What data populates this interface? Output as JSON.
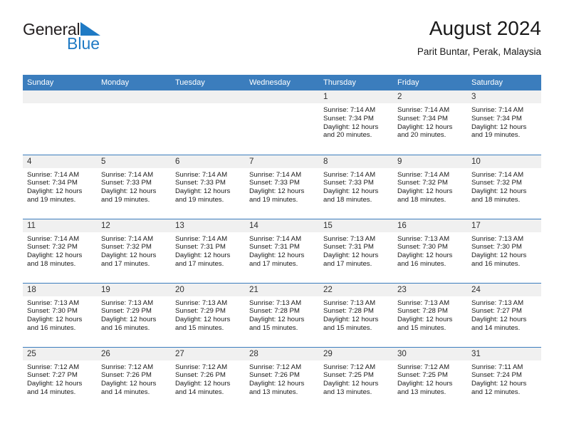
{
  "brand": {
    "name_part1": "General",
    "name_part2": "Blue",
    "accent_color": "#1f7ac4"
  },
  "header": {
    "title": "August 2024",
    "subtitle": "Parit Buntar, Perak, Malaysia"
  },
  "theme": {
    "header_bg": "#3b7dbd",
    "daynum_bg": "#f0f0f0",
    "text": "#1a1a1a"
  },
  "weekday_headers": [
    "Sunday",
    "Monday",
    "Tuesday",
    "Wednesday",
    "Thursday",
    "Friday",
    "Saturday"
  ],
  "labels": {
    "sunrise": "Sunrise:",
    "sunset": "Sunset:",
    "daylight": "Daylight:"
  },
  "weeks": [
    [
      {
        "day": "",
        "lines": []
      },
      {
        "day": "",
        "lines": []
      },
      {
        "day": "",
        "lines": []
      },
      {
        "day": "",
        "lines": []
      },
      {
        "day": "1",
        "lines": [
          "Sunrise: 7:14 AM",
          "Sunset: 7:34 PM",
          "Daylight: 12 hours",
          "and 20 minutes."
        ]
      },
      {
        "day": "2",
        "lines": [
          "Sunrise: 7:14 AM",
          "Sunset: 7:34 PM",
          "Daylight: 12 hours",
          "and 20 minutes."
        ]
      },
      {
        "day": "3",
        "lines": [
          "Sunrise: 7:14 AM",
          "Sunset: 7:34 PM",
          "Daylight: 12 hours",
          "and 19 minutes."
        ]
      }
    ],
    [
      {
        "day": "4",
        "lines": [
          "Sunrise: 7:14 AM",
          "Sunset: 7:34 PM",
          "Daylight: 12 hours",
          "and 19 minutes."
        ]
      },
      {
        "day": "5",
        "lines": [
          "Sunrise: 7:14 AM",
          "Sunset: 7:33 PM",
          "Daylight: 12 hours",
          "and 19 minutes."
        ]
      },
      {
        "day": "6",
        "lines": [
          "Sunrise: 7:14 AM",
          "Sunset: 7:33 PM",
          "Daylight: 12 hours",
          "and 19 minutes."
        ]
      },
      {
        "day": "7",
        "lines": [
          "Sunrise: 7:14 AM",
          "Sunset: 7:33 PM",
          "Daylight: 12 hours",
          "and 19 minutes."
        ]
      },
      {
        "day": "8",
        "lines": [
          "Sunrise: 7:14 AM",
          "Sunset: 7:33 PM",
          "Daylight: 12 hours",
          "and 18 minutes."
        ]
      },
      {
        "day": "9",
        "lines": [
          "Sunrise: 7:14 AM",
          "Sunset: 7:32 PM",
          "Daylight: 12 hours",
          "and 18 minutes."
        ]
      },
      {
        "day": "10",
        "lines": [
          "Sunrise: 7:14 AM",
          "Sunset: 7:32 PM",
          "Daylight: 12 hours",
          "and 18 minutes."
        ]
      }
    ],
    [
      {
        "day": "11",
        "lines": [
          "Sunrise: 7:14 AM",
          "Sunset: 7:32 PM",
          "Daylight: 12 hours",
          "and 18 minutes."
        ]
      },
      {
        "day": "12",
        "lines": [
          "Sunrise: 7:14 AM",
          "Sunset: 7:32 PM",
          "Daylight: 12 hours",
          "and 17 minutes."
        ]
      },
      {
        "day": "13",
        "lines": [
          "Sunrise: 7:14 AM",
          "Sunset: 7:31 PM",
          "Daylight: 12 hours",
          "and 17 minutes."
        ]
      },
      {
        "day": "14",
        "lines": [
          "Sunrise: 7:14 AM",
          "Sunset: 7:31 PM",
          "Daylight: 12 hours",
          "and 17 minutes."
        ]
      },
      {
        "day": "15",
        "lines": [
          "Sunrise: 7:13 AM",
          "Sunset: 7:31 PM",
          "Daylight: 12 hours",
          "and 17 minutes."
        ]
      },
      {
        "day": "16",
        "lines": [
          "Sunrise: 7:13 AM",
          "Sunset: 7:30 PM",
          "Daylight: 12 hours",
          "and 16 minutes."
        ]
      },
      {
        "day": "17",
        "lines": [
          "Sunrise: 7:13 AM",
          "Sunset: 7:30 PM",
          "Daylight: 12 hours",
          "and 16 minutes."
        ]
      }
    ],
    [
      {
        "day": "18",
        "lines": [
          "Sunrise: 7:13 AM",
          "Sunset: 7:30 PM",
          "Daylight: 12 hours",
          "and 16 minutes."
        ]
      },
      {
        "day": "19",
        "lines": [
          "Sunrise: 7:13 AM",
          "Sunset: 7:29 PM",
          "Daylight: 12 hours",
          "and 16 minutes."
        ]
      },
      {
        "day": "20",
        "lines": [
          "Sunrise: 7:13 AM",
          "Sunset: 7:29 PM",
          "Daylight: 12 hours",
          "and 15 minutes."
        ]
      },
      {
        "day": "21",
        "lines": [
          "Sunrise: 7:13 AM",
          "Sunset: 7:28 PM",
          "Daylight: 12 hours",
          "and 15 minutes."
        ]
      },
      {
        "day": "22",
        "lines": [
          "Sunrise: 7:13 AM",
          "Sunset: 7:28 PM",
          "Daylight: 12 hours",
          "and 15 minutes."
        ]
      },
      {
        "day": "23",
        "lines": [
          "Sunrise: 7:13 AM",
          "Sunset: 7:28 PM",
          "Daylight: 12 hours",
          "and 15 minutes."
        ]
      },
      {
        "day": "24",
        "lines": [
          "Sunrise: 7:13 AM",
          "Sunset: 7:27 PM",
          "Daylight: 12 hours",
          "and 14 minutes."
        ]
      }
    ],
    [
      {
        "day": "25",
        "lines": [
          "Sunrise: 7:12 AM",
          "Sunset: 7:27 PM",
          "Daylight: 12 hours",
          "and 14 minutes."
        ]
      },
      {
        "day": "26",
        "lines": [
          "Sunrise: 7:12 AM",
          "Sunset: 7:26 PM",
          "Daylight: 12 hours",
          "and 14 minutes."
        ]
      },
      {
        "day": "27",
        "lines": [
          "Sunrise: 7:12 AM",
          "Sunset: 7:26 PM",
          "Daylight: 12 hours",
          "and 14 minutes."
        ]
      },
      {
        "day": "28",
        "lines": [
          "Sunrise: 7:12 AM",
          "Sunset: 7:26 PM",
          "Daylight: 12 hours",
          "and 13 minutes."
        ]
      },
      {
        "day": "29",
        "lines": [
          "Sunrise: 7:12 AM",
          "Sunset: 7:25 PM",
          "Daylight: 12 hours",
          "and 13 minutes."
        ]
      },
      {
        "day": "30",
        "lines": [
          "Sunrise: 7:12 AM",
          "Sunset: 7:25 PM",
          "Daylight: 12 hours",
          "and 13 minutes."
        ]
      },
      {
        "day": "31",
        "lines": [
          "Sunrise: 7:11 AM",
          "Sunset: 7:24 PM",
          "Daylight: 12 hours",
          "and 12 minutes."
        ]
      }
    ]
  ]
}
